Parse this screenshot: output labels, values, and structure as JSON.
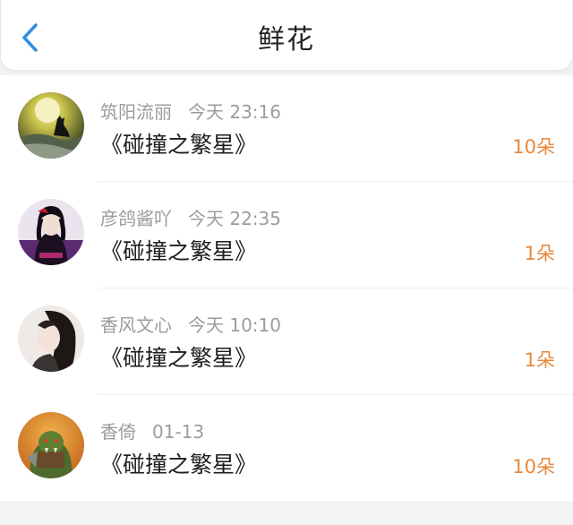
{
  "header": {
    "title": "鲜花",
    "back_icon": "chevron-left-icon",
    "accent_color": "#2f8fe0"
  },
  "items": [
    {
      "name": "筑阳流丽",
      "time": "今天 23:16",
      "book": "《碰撞之繁星》",
      "count": "10朵",
      "avatar_icon": "wolf-moon-avatar"
    },
    {
      "name": "彦鸽酱吖",
      "time": "今天 22:35",
      "book": "《碰撞之繁星》",
      "count": "1朵",
      "avatar_icon": "gothic-girl-avatar"
    },
    {
      "name": "香风文心",
      "time": "今天 10:10",
      "book": "《碰撞之繁星》",
      "count": "1朵",
      "avatar_icon": "girl-portrait-avatar"
    },
    {
      "name": "香倚",
      "time": "01-13",
      "book": "《碰撞之繁星》",
      "count": "10朵",
      "avatar_icon": "orc-warrior-avatar"
    }
  ],
  "colors": {
    "count": "#e8893a",
    "meta": "#9c9c9c"
  }
}
